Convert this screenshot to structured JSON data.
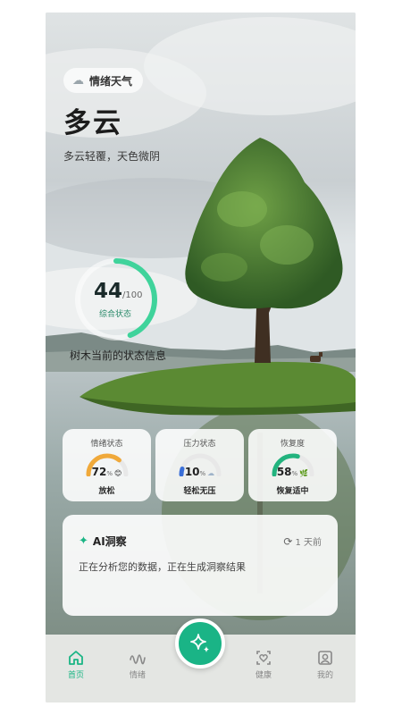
{
  "header": {
    "pill_label": "情绪天气",
    "pill_icon": "cloud-icon",
    "weather_title": "多云",
    "weather_desc": "多云轻覆，天色微阴"
  },
  "overall": {
    "score": "44",
    "max": "/100",
    "label": "综合状态",
    "progress": 0.44,
    "ring_color": "#3fd39b"
  },
  "tree_info": "树木当前的状态信息",
  "metrics": [
    {
      "title": "情绪状态",
      "value": "72",
      "unit": "%",
      "icon": "smile-emoji-icon",
      "status": "放松",
      "color": "#f0a93a",
      "progress": 0.72
    },
    {
      "title": "压力状态",
      "value": "10",
      "unit": "%",
      "icon": "cloud-icon",
      "status": "轻松无压",
      "color": "#3a6fd8",
      "progress": 0.1
    },
    {
      "title": "恢复度",
      "value": "58",
      "unit": "%",
      "icon": "leaf-icon",
      "status": "恢复适中",
      "color": "#22b37e",
      "progress": 0.58
    }
  ],
  "ai": {
    "title": "AI洞察",
    "time": "1 天前",
    "body": "正在分析您的数据，正在生成洞察结果"
  },
  "nav": {
    "home": "首页",
    "mood": "情绪",
    "health": "健康",
    "mine": "我的"
  },
  "colors": {
    "accent": "#1ab486",
    "nav_bg": "#e4e6e3"
  }
}
